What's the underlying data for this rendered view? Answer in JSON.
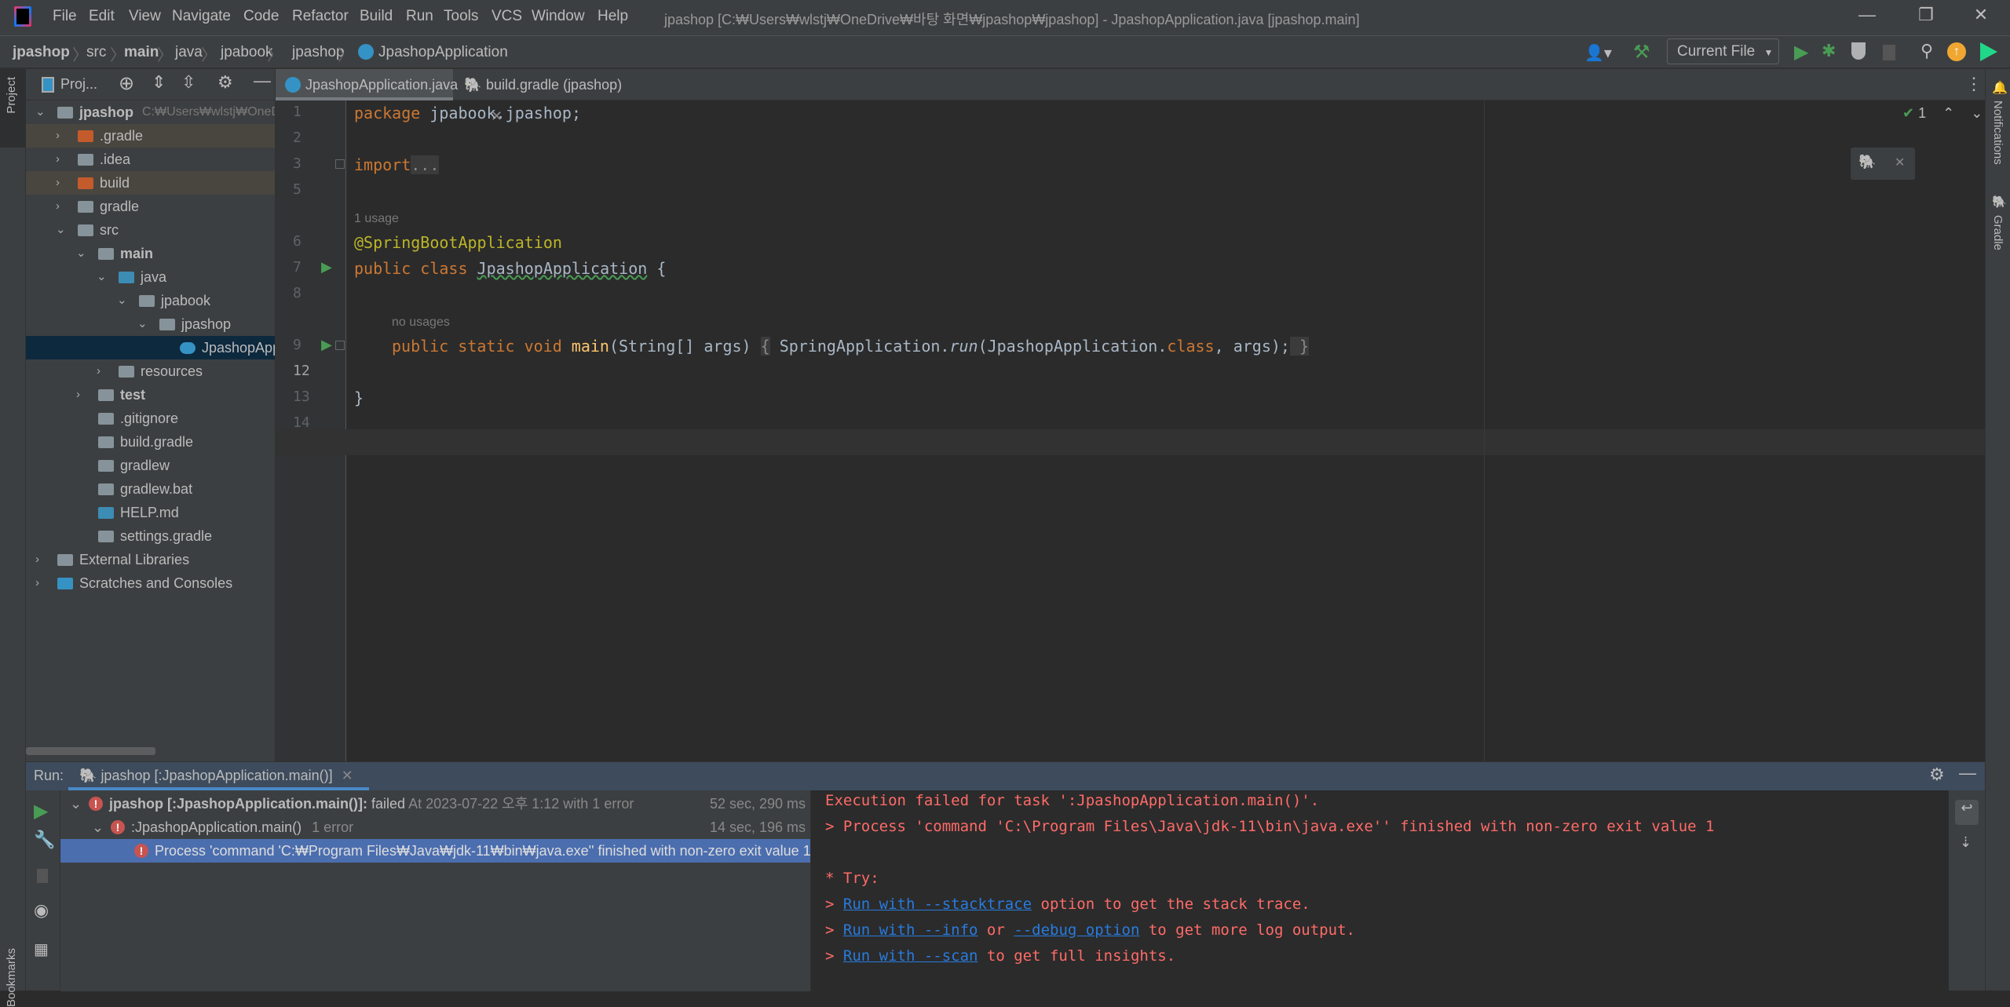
{
  "titlebar": {
    "menu": [
      "File",
      "Edit",
      "View",
      "Navigate",
      "Code",
      "Refactor",
      "Build",
      "Run",
      "Tools",
      "VCS",
      "Window",
      "Help"
    ],
    "title": "jpashop [C:₩Users₩wlstj₩OneDrive₩바탕 화면₩jpashop₩jpashop] - JpashopApplication.java [jpashop.main]"
  },
  "breadcrumb": [
    "jpashop",
    "src",
    "main",
    "java",
    "jpabook",
    "jpashop",
    "JpashopApplication"
  ],
  "toolbar": {
    "run_config": "Current File"
  },
  "left_strip": {
    "project": "Project",
    "bookmarks": "Bookmarks"
  },
  "right_strip": {
    "notifications": "Notifications",
    "gradle": "Gradle"
  },
  "project": {
    "title": "Proj...",
    "tree": [
      {
        "label": "jpashop",
        "path": "C:₩Users₩wlstj₩OneDrive",
        "level": 0,
        "expanded": true,
        "bold": true,
        "icon": "module-folder"
      },
      {
        "label": ".gradle",
        "level": 1,
        "expanded": false,
        "icon": "excluded-folder",
        "highlight": true
      },
      {
        "label": ".idea",
        "level": 1,
        "expanded": false,
        "icon": "folder"
      },
      {
        "label": "build",
        "level": 1,
        "expanded": false,
        "icon": "excluded-folder",
        "highlight": true
      },
      {
        "label": "gradle",
        "level": 1,
        "expanded": false,
        "icon": "folder"
      },
      {
        "label": "src",
        "level": 1,
        "expanded": true,
        "icon": "folder"
      },
      {
        "label": "main",
        "level": 2,
        "expanded": true,
        "bold": true,
        "icon": "module-folder"
      },
      {
        "label": "java",
        "level": 3,
        "expanded": true,
        "icon": "source-folder"
      },
      {
        "label": "jpabook",
        "level": 4,
        "expanded": true,
        "icon": "package"
      },
      {
        "label": "jpashop",
        "level": 5,
        "expanded": true,
        "icon": "package"
      },
      {
        "label": "JpashopApplication",
        "level": 6,
        "icon": "spring-class",
        "selected": true
      },
      {
        "label": "resources",
        "level": 3,
        "expanded": false,
        "icon": "resources-folder"
      },
      {
        "label": "test",
        "level": 2,
        "expanded": false,
        "bold": true,
        "icon": "module-folder"
      },
      {
        "label": ".gitignore",
        "level": 2,
        "icon": "ignore-file"
      },
      {
        "label": "build.gradle",
        "level": 2,
        "icon": "gradle-file"
      },
      {
        "label": "gradlew",
        "level": 2,
        "icon": "shell-file"
      },
      {
        "label": "gradlew.bat",
        "level": 2,
        "icon": "text-file"
      },
      {
        "label": "HELP.md",
        "level": 2,
        "icon": "markdown-file"
      },
      {
        "label": "settings.gradle",
        "level": 2,
        "icon": "gradle-file"
      },
      {
        "label": "External Libraries",
        "level": 0,
        "expanded": false,
        "icon": "libraries"
      },
      {
        "label": "Scratches and Consoles",
        "level": 0,
        "expanded": false,
        "icon": "scratches"
      }
    ]
  },
  "editor": {
    "tabs": [
      {
        "label": "JpashopApplication.java",
        "active": true,
        "icon": "spring-class"
      },
      {
        "label": "build.gradle (jpashop)",
        "active": false,
        "icon": "gradle-file"
      }
    ],
    "inspection_count": "1",
    "line_numbers": [
      "1",
      "2",
      "3",
      "5",
      "",
      "6",
      "7",
      "8",
      "",
      "9",
      "12",
      "13",
      "14"
    ],
    "hints": {
      "usage": "1 usage",
      "no_usages": "no usages"
    },
    "code": {
      "l1_kw": "package",
      "l1_rest": " jpabook.jpashop;",
      "l3_kw": "import",
      "l3_fold": "...",
      "l6": "@SpringBootApplication",
      "l7_kw": "public class ",
      "l7_name": "JpashopApplication",
      "l7_rest": " {",
      "l9_kw": "public static void ",
      "l9_fn": "main",
      "l9_sig": "(String[] args) ",
      "l9_ob": "{",
      "l9_call": " SpringApplication.",
      "l9_run": "run",
      "l9_arg": "(JpashopApplication.",
      "l9_class": "class",
      "l9_end": ", args);",
      "l9_cb": " }",
      "l13": "}"
    }
  },
  "run": {
    "label": "Run:",
    "tab": "jpashop [:JpashopApplication.main()]",
    "tree": [
      {
        "name": "jpashop [:JpashopApplication.main()]:",
        "status": "failed",
        "detail": "At 2023-07-22 오후 1:12 with 1 error",
        "duration": "52 sec, 290 ms"
      },
      {
        "name": ":JpashopApplication.main()",
        "detail": "1 error",
        "duration": "14 sec, 196 ms"
      },
      {
        "name": "Process 'command 'C:₩Program Files₩Java₩jdk-11₩bin₩java.exe'' finished with non-zero exit value 1"
      }
    ],
    "console": {
      "line1": "Execution failed for task ':JpashopApplication.main()'.",
      "line2": "> Process 'command 'C:\\Program Files\\Java\\jdk-11\\bin\\java.exe'' finished with non-zero exit value 1",
      "try": "* Try:",
      "prompt": "> ",
      "l5_link": "Run with --stacktrace",
      "l5_rest": " option to get the stack trace.",
      "l6_link1": "Run with --info",
      "l6_mid": " or ",
      "l6_link2": "--debug option",
      "l6_rest": " to get more log output.",
      "l7_link": "Run with --scan",
      "l7_rest": " to get full insights."
    }
  },
  "colors": {
    "error": "#ff6b68",
    "link": "#287bde",
    "selection": "#4b6eaf",
    "keyword": "#cc7832",
    "annotation": "#bbb529"
  }
}
